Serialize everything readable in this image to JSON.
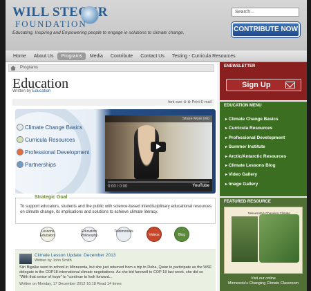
{
  "header": {
    "logo_line1": "WILL STEGER",
    "logo_line2": "FOUNDATION",
    "tagline": "Educating, Inspiring and Empowering people to engage in solutions to climate change.",
    "search_placeholder": "Search...",
    "contribute_label": "CONTRIBUTE NOW"
  },
  "nav": {
    "items": [
      {
        "label": "Home"
      },
      {
        "label": "About Us"
      },
      {
        "label": "Programs",
        "active": true
      },
      {
        "label": "Media"
      },
      {
        "label": "Contribute"
      },
      {
        "label": "Contact Us"
      },
      {
        "label": "Testing - Curricula Resources"
      }
    ]
  },
  "breadcrumb": {
    "label": "Programs"
  },
  "page": {
    "title": "Education",
    "written_by_prefix": "Written by",
    "written_by": "Education",
    "tools": "font size  ⊖  ⊕   Print   E-mail"
  },
  "banner": {
    "items": [
      {
        "label": "Climate Change Basics"
      },
      {
        "label": "Curricula Resources"
      },
      {
        "label": "Professional Development"
      },
      {
        "label": "Partnerships"
      }
    ],
    "video_top": "Share   More info",
    "video_time": "0:00 / 0:00",
    "video_brand": "YouTube"
  },
  "goal": {
    "title": "Strategic Goal",
    "text": "To support educators, students and the public with science-based interdisciplinary educational resources on climate change, its implications and solutions to achieve climate literacy."
  },
  "icons": [
    {
      "label": "Lessons Educators"
    },
    {
      "label": "Education Philosophy"
    },
    {
      "label": "Testimonials"
    },
    {
      "label": "Videos"
    },
    {
      "label": "Blog"
    }
  ],
  "news": {
    "title": "Climate Lesson Update: December 2013",
    "author": "Written by John Smith",
    "text": "Siiri Bigalke went to school in Minnesota, but she just returned from a trip to Doha, Qatar to participate as the WSF delegate in the COP18 international climate negotiations. As she bid farewell to COP 18 last week, she did so \"With that sense of hope\" to \"continue to look forward...",
    "meta": "Written on Monday, 17 December 2012 16:18   Read 14 times"
  },
  "sidebar": {
    "enews_title": "ENEWSLETTER",
    "signup_label": "Sign Up",
    "menu_title": "EDUCATION MENU",
    "menu_items": [
      {
        "label": "Climate Change Basics"
      },
      {
        "label": "Curricula Resources"
      },
      {
        "label": "Professional Development"
      },
      {
        "label": "Summer Institute"
      },
      {
        "label": "Arctic/Antarctic Resources"
      },
      {
        "label": "Climate Lessons Blog"
      },
      {
        "label": "Video Gallery"
      },
      {
        "label": "Image Gallery"
      }
    ],
    "featured_title": "FEATURED RESOURCE",
    "featured_caption": "Minnesota's Changing Climate",
    "visit_line1": "Visit our online",
    "visit_line2": "Minnesota's Changing Climate Classroom"
  }
}
